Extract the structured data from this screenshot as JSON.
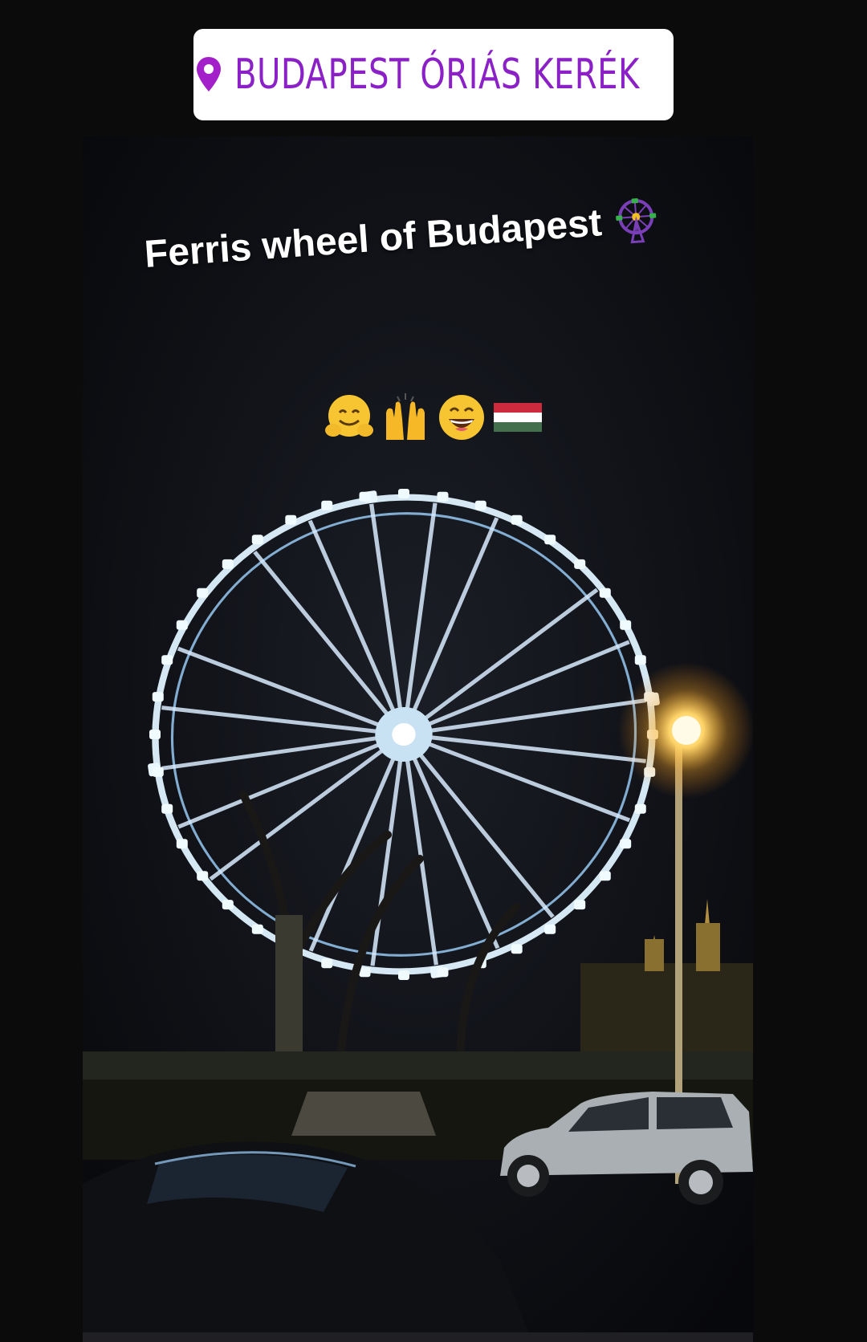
{
  "location": {
    "label": "BUDAPEST ÓRIÁS KERÉK",
    "icon": "location-pin-icon",
    "color": "#8a20c6"
  },
  "caption": {
    "text": "Ferris wheel of Budapest",
    "icon": "ferris-wheel-icon"
  },
  "emojis": [
    {
      "name": "hugging-face-icon"
    },
    {
      "name": "raising-hands-icon"
    },
    {
      "name": "grinning-face-icon"
    },
    {
      "name": "hungary-flag-icon"
    }
  ]
}
